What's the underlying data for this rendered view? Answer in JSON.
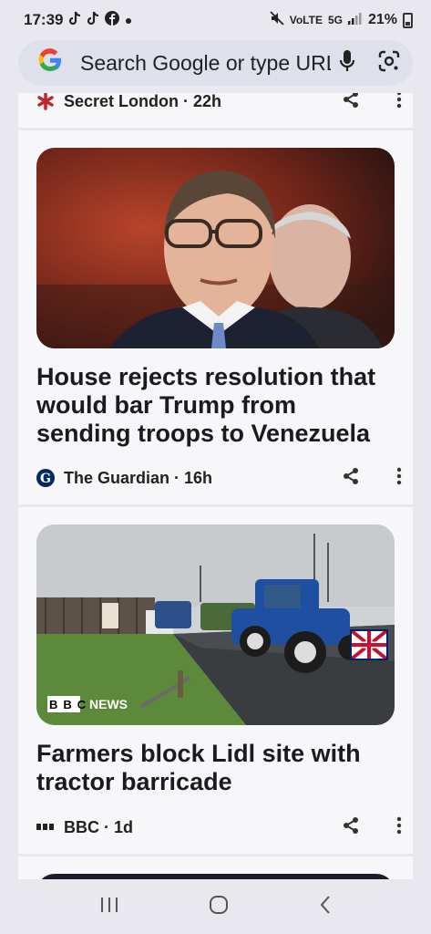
{
  "status_bar": {
    "time": "17:39",
    "network_label": "VoLTE",
    "signal_label": "5G",
    "battery": "21%",
    "icons": [
      "tiktok-icon",
      "tiktok-icon",
      "facebook-icon",
      "dot-icon",
      "mute-icon",
      "signal-icon",
      "battery-icon"
    ]
  },
  "search": {
    "placeholder": "Search Google or type URL",
    "logo": "G",
    "icons": [
      "microphone-icon",
      "lens-icon"
    ]
  },
  "feed": {
    "cards": [
      {
        "source": "Secret London · 22h",
        "icon": "asterisk-icon"
      },
      {
        "headline": "House rejects resolution that would bar Trump from sending troops to Venezuela",
        "source": "The Guardian · 16h",
        "icon": "guardian-icon"
      },
      {
        "headline": "Farmers block Lidl site with tractor barricade",
        "source": "BBC · 1d",
        "icon": "bbc-icon",
        "image_watermark": "BBC NEWS"
      }
    ]
  },
  "nav": {
    "icons": [
      "recents-icon",
      "home-icon",
      "back-icon"
    ]
  }
}
